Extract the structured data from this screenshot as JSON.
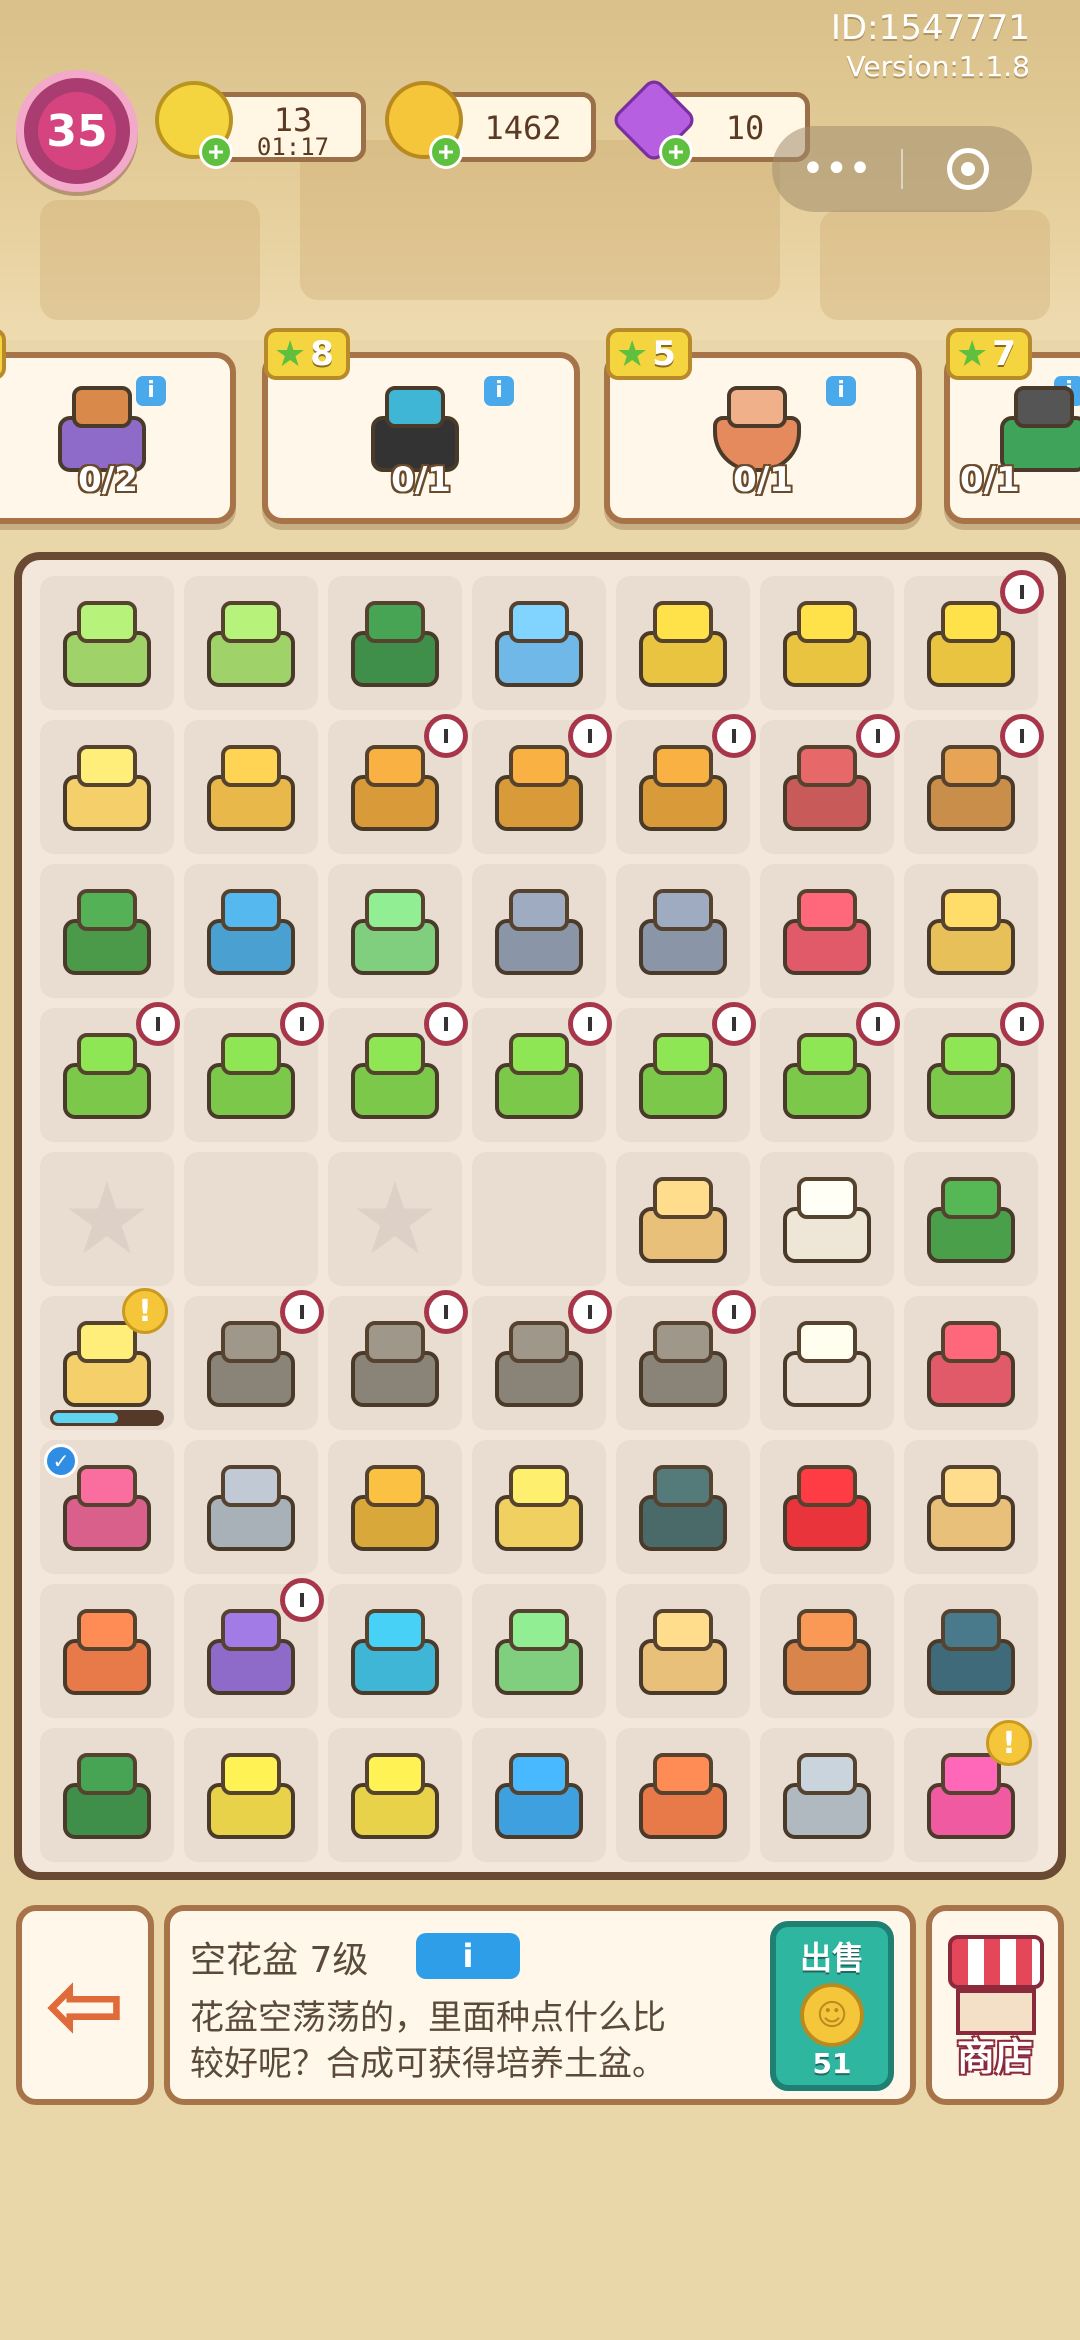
{
  "header": {
    "player_id": "ID:1547771",
    "version": "Version:1.1.8",
    "level": "35",
    "energy": {
      "value": "13",
      "timer": "01:17",
      "icon": "lightning-icon",
      "color": "#f5d53f"
    },
    "coins": {
      "value": "1462",
      "icon": "coin-icon",
      "color": "#f5c53a"
    },
    "gems": {
      "value": "10",
      "icon": "gem-icon",
      "color": "#b65fe0"
    },
    "capsule": {
      "more": "•••"
    }
  },
  "orders": [
    {
      "reward": "",
      "count": "0/2",
      "item": "junk-basket",
      "color": "#8e6bc9"
    },
    {
      "reward": "8",
      "count": "0/1",
      "item": "exercise-bike",
      "color": "#3fb6d6"
    },
    {
      "reward": "5",
      "count": "0/1",
      "item": "clay-pot",
      "color": "#e58a5c"
    },
    {
      "reward": "7",
      "count": "0/1",
      "item": "power-drill",
      "color": "#3fa35a"
    }
  ],
  "board": {
    "cells": [
      {
        "item": "laptop",
        "color": "#9fd36a"
      },
      {
        "item": "laptop",
        "color": "#9fd36a"
      },
      {
        "item": "green-machine",
        "color": "#3f8f4a"
      },
      {
        "item": "blue-printer",
        "color": "#6fb8e8"
      },
      {
        "item": "shopping-cart",
        "color": "#e8c440"
      },
      {
        "item": "chick-cart",
        "color": "#e8c440"
      },
      {
        "item": "cart-junk",
        "color": "#e8c440",
        "clock": true
      },
      {
        "item": "duck-float",
        "color": "#f5d06a"
      },
      {
        "item": "seed-pot",
        "color": "#e8b84a"
      },
      {
        "item": "cabinet",
        "color": "#d99a3a",
        "clock": true
      },
      {
        "item": "cabinet-open",
        "color": "#d99a3a",
        "clock": true
      },
      {
        "item": "cabinet",
        "color": "#d99a3a",
        "clock": true
      },
      {
        "item": "wheelbarrow",
        "color": "#c85a5a",
        "clock": true
      },
      {
        "item": "flower-basket",
        "color": "#c98f4a",
        "clock": true
      },
      {
        "item": "hacksaw",
        "color": "#4a9a4a"
      },
      {
        "item": "paint-roller",
        "color": "#4aa0d0"
      },
      {
        "item": "cash",
        "color": "#7fcf7f"
      },
      {
        "item": "snail-shell",
        "color": "#8a95a8"
      },
      {
        "item": "shell",
        "color": "#8a95a8"
      },
      {
        "item": "tool-bucket",
        "color": "#e05a6a"
      },
      {
        "item": "empty-pot",
        "color": "#e8c05a"
      },
      {
        "item": "potted-tree",
        "color": "#7cc84a",
        "clock": true
      },
      {
        "item": "potted-tree",
        "color": "#7cc84a",
        "clock": true
      },
      {
        "item": "potted-tree",
        "color": "#7cc84a",
        "clock": true
      },
      {
        "item": "potted-tree",
        "color": "#7cc84a",
        "clock": true
      },
      {
        "item": "potted-tree",
        "color": "#7cc84a",
        "clock": true
      },
      {
        "item": "potted-tree",
        "color": "#7cc84a",
        "clock": true
      },
      {
        "item": "potted-tree",
        "color": "#7cc84a",
        "clock": true
      },
      {
        "item": "star-slot"
      },
      {
        "item": "empty"
      },
      {
        "item": "star-slot"
      },
      {
        "item": "empty"
      },
      {
        "item": "hamster",
        "color": "#e8c07a"
      },
      {
        "item": "mouse",
        "color": "#eee6d6"
      },
      {
        "item": "pliers",
        "color": "#4aa04a"
      },
      {
        "item": "duck-float",
        "color": "#f5d06a",
        "excl": true,
        "progress": 0.6
      },
      {
        "item": "trash-bag",
        "color": "#8a8478",
        "clock": true
      },
      {
        "item": "trash-bag",
        "color": "#8a8478",
        "clock": true
      },
      {
        "item": "trash-bag",
        "color": "#8a8478",
        "clock": true
      },
      {
        "item": "trash-bag",
        "color": "#8a8478",
        "clock": true
      },
      {
        "item": "paint-roller",
        "color": "#e8ddd0"
      },
      {
        "item": "snail",
        "color": "#e05a6a"
      },
      {
        "item": "bricks",
        "color": "#d9608a",
        "check": true
      },
      {
        "item": "snail",
        "color": "#a8b0b8"
      },
      {
        "item": "medal",
        "color": "#d9a83a"
      },
      {
        "item": "medal-silver",
        "color": "#f0d060"
      },
      {
        "item": "closed-sign",
        "color": "#4a6a6a"
      },
      {
        "item": "rosette",
        "color": "#e8343a"
      },
      {
        "item": "hamster",
        "color": "#e8c07a"
      },
      {
        "item": "hammer",
        "color": "#e87a4a"
      },
      {
        "item": "junk-basket",
        "color": "#8e6bc9",
        "clock": true
      },
      {
        "item": "ring",
        "color": "#3fb6d6"
      },
      {
        "item": "cash-stack",
        "color": "#7fcf7f"
      },
      {
        "item": "hamsters",
        "color": "#e8c07a"
      },
      {
        "item": "clay-pot",
        "color": "#d9844a"
      },
      {
        "item": "ab-wheel",
        "color": "#3f6a7a"
      },
      {
        "item": "toolbox",
        "color": "#3f8f4a"
      },
      {
        "item": "yellow-basket",
        "color": "#e8d24a"
      },
      {
        "item": "frame",
        "color": "#e8d24a"
      },
      {
        "item": "robot-vacuum",
        "color": "#3fa0e0"
      },
      {
        "item": "pickaxe",
        "color": "#e87a4a"
      },
      {
        "item": "dumbbells",
        "color": "#b0b8c0"
      },
      {
        "item": "pink-backpack",
        "color": "#f05aa0",
        "excl": true
      }
    ]
  },
  "info": {
    "title": "空花盆 7级",
    "info_label": "i",
    "desc_line1": "花盆空荡荡的，里面种点什么比",
    "desc_line2": "较好呢？合成可获得培养土盆。",
    "sell_label": "出售",
    "sell_price": "51",
    "shop_label": "商店"
  },
  "colors": {
    "board_border": "#6b4a33",
    "panel_border": "#a7744a",
    "accent": "#2f9ee8"
  }
}
